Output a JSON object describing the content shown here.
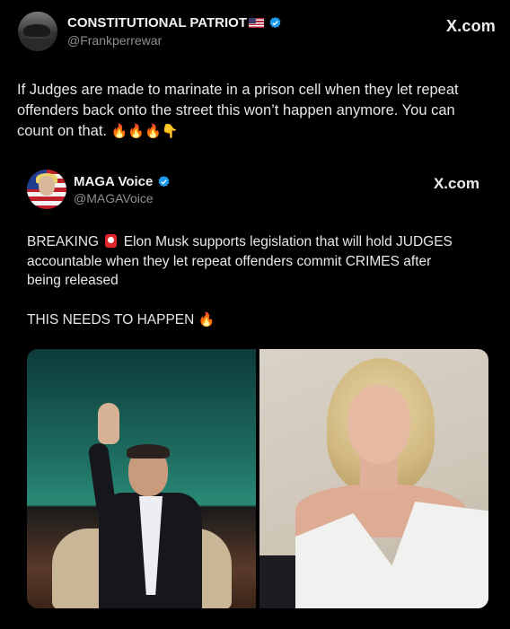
{
  "outer_tweet": {
    "display_name": "CONSTITUTIONAL PATRIOT",
    "handle": "@Frankperrewar",
    "brand": "X.com",
    "text_line1": "If Judges are made to marinate in a prison cell when they let repeat",
    "text_line2": "offenders back onto the street this won’t happen anymore. You can",
    "text_line3": "count on that.",
    "emojis": "🔥🔥🔥👇"
  },
  "inner_tweet": {
    "display_name": "MAGA Voice",
    "handle": "@MAGAVoice",
    "brand": "X.com",
    "text_word1": "BREAKING",
    "text_rest_line1": "Elon Musk supports legislation that will hold JUDGES",
    "text_line2": "accountable when they let repeat offenders commit CRIMES after",
    "text_line3": "being released",
    "text_emphasis": "THIS NEEDS TO HAPPEN",
    "emphasis_emoji": "🔥"
  },
  "colors": {
    "background": "#000000",
    "verified": "#1d9bf0",
    "handle_gray": "#8b8f94"
  },
  "icons": [
    "flag-icon",
    "verified-icon",
    "siren-icon",
    "fire-icon",
    "pointing-down-icon"
  ]
}
